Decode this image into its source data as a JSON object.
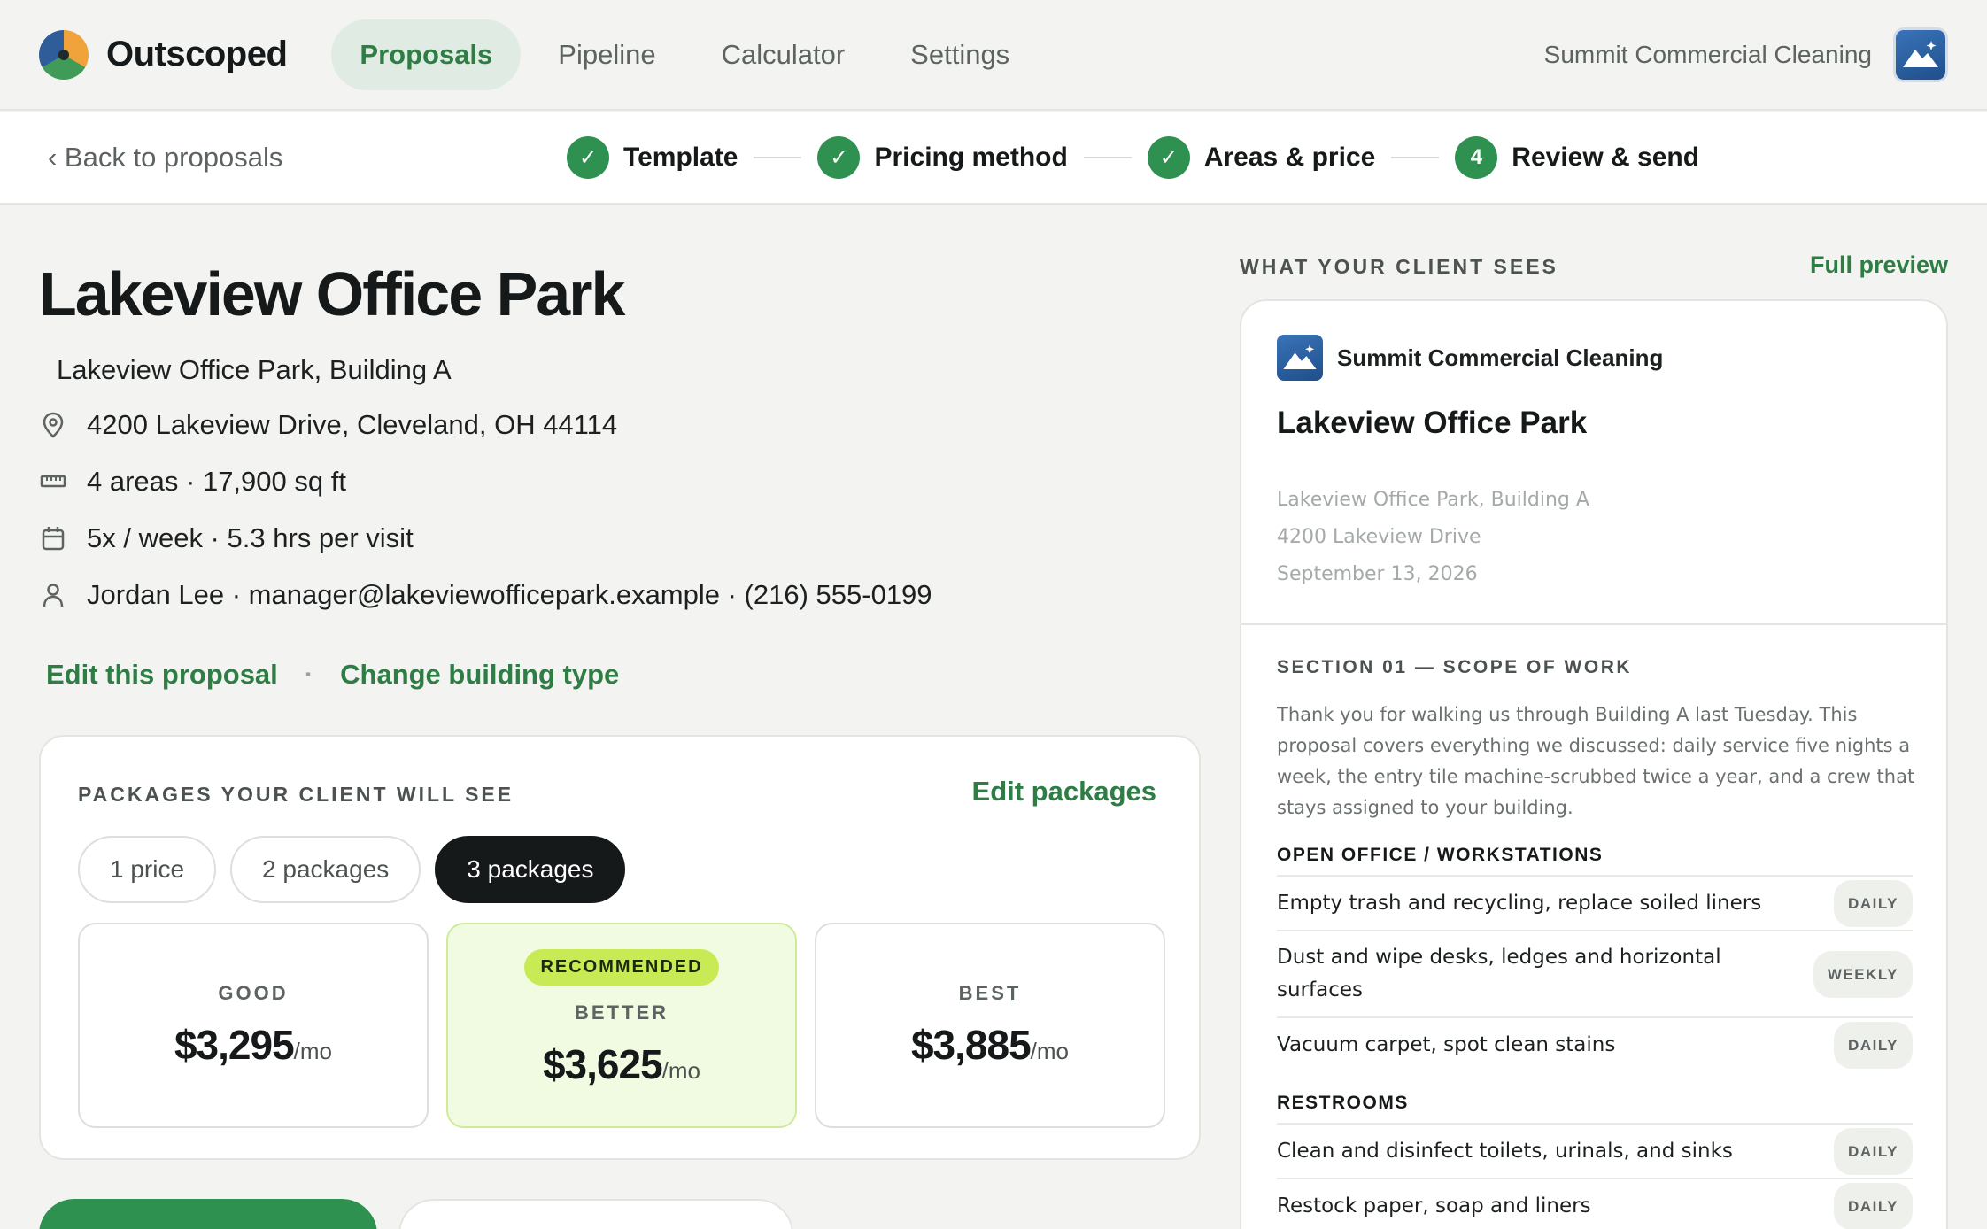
{
  "nav": {
    "brand": "Outscoped",
    "tabs": [
      "Proposals",
      "Pipeline",
      "Calculator",
      "Settings"
    ],
    "active_tab": "Proposals",
    "account_name": "Summit Commercial Cleaning"
  },
  "stepper": {
    "back_label": "‹ Back to proposals",
    "steps": [
      {
        "label": "Template",
        "state": "done",
        "marker": "✓"
      },
      {
        "label": "Pricing method",
        "state": "done",
        "marker": "✓"
      },
      {
        "label": "Areas & price",
        "state": "done",
        "marker": "✓"
      },
      {
        "label": "Review & send",
        "state": "current",
        "marker": "4"
      }
    ]
  },
  "proposal": {
    "title": "Lakeview Office Park",
    "subtitle": "Lakeview Office Park, Building A",
    "address": "4200 Lakeview Drive, Cleveland, OH 44114",
    "areas": "4 areas · 17,900 sq ft",
    "schedule": "5x / week · 5.3 hrs per visit",
    "contact": "Jordan Lee · manager@lakeviewofficepark.example · (216) 555-0199",
    "edit_link": "Edit this proposal",
    "separator": "·",
    "change_link": "Change building type"
  },
  "packages": {
    "heading": "PACKAGES YOUR CLIENT WILL SEE",
    "edit_label": "Edit packages",
    "options": [
      "1 price",
      "2 packages",
      "3 packages"
    ],
    "selected_option": "3 packages",
    "tiers": [
      {
        "name": "GOOD",
        "price": "$3,295",
        "per": "/mo",
        "badge": ""
      },
      {
        "name": "BETTER",
        "price": "$3,625",
        "per": "/mo",
        "badge": "RECOMMENDED"
      },
      {
        "name": "BEST",
        "price": "$3,885",
        "per": "/mo",
        "badge": ""
      }
    ]
  },
  "preview": {
    "label": "WHAT YOUR CLIENT SEES",
    "full_preview": "Full preview",
    "company": "Summit Commercial Cleaning",
    "title": "Lakeview Office Park",
    "meta": [
      "Lakeview Office Park, Building A",
      "4200 Lakeview Drive",
      "September 13, 2026"
    ],
    "section": "SECTION 01 — SCOPE OF WORK",
    "intro": "Thank you for walking us through Building A last Tuesday. This proposal covers everything we discussed: daily service five nights a week, the entry tile machine-scrubbed twice a year, and a crew that stays assigned to your building.",
    "groups": [
      {
        "name": "OPEN OFFICE / WORKSTATIONS",
        "tasks": [
          {
            "text": "Empty trash and recycling, replace soiled liners",
            "freq": "DAILY"
          },
          {
            "text": "Dust and wipe desks, ledges and horizontal surfaces",
            "freq": "WEEKLY"
          },
          {
            "text": "Vacuum carpet, spot clean stains",
            "freq": "DAILY"
          }
        ]
      },
      {
        "name": "RESTROOMS",
        "tasks": [
          {
            "text": "Clean and disinfect toilets, urinals, and sinks",
            "freq": "DAILY"
          },
          {
            "text": "Restock paper, soap and liners",
            "freq": "DAILY"
          }
        ]
      }
    ]
  },
  "colors": {
    "accent": "#2e7d44",
    "step_done": "#2e9150",
    "recommended_badge": "#c8ea54",
    "recommended_bg": "#f1fbe2"
  }
}
